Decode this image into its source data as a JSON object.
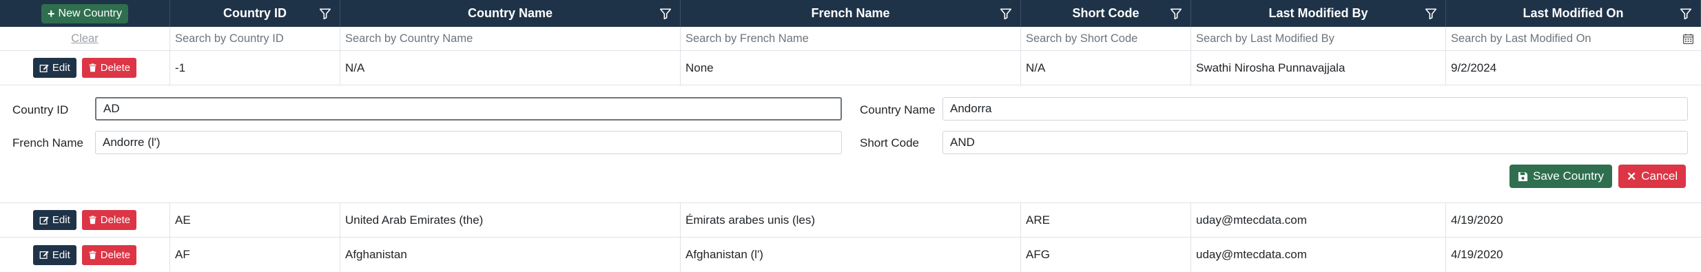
{
  "toolbar": {
    "new_label": "New Country"
  },
  "columns": [
    {
      "label": "Country ID",
      "placeholder": "Search by Country ID"
    },
    {
      "label": "Country Name",
      "placeholder": "Search by Country Name"
    },
    {
      "label": "French Name",
      "placeholder": "Search by French Name"
    },
    {
      "label": "Short Code",
      "placeholder": "Search by Short Code"
    },
    {
      "label": "Last Modified By",
      "placeholder": "Search by Last Modified By"
    },
    {
      "label": "Last Modified On",
      "placeholder": "Search by Last Modified On"
    }
  ],
  "filter": {
    "clear_label": "Clear"
  },
  "row_actions": {
    "edit_label": "Edit",
    "delete_label": "Delete"
  },
  "rows": [
    {
      "id": "-1",
      "name": "N/A",
      "french": "None",
      "code": "N/A",
      "modified_by": "Swathi Nirosha Punnavajjala",
      "modified_on": "9/2/2024"
    },
    {
      "id": "AE",
      "name": "United Arab Emirates (the)",
      "french": "Émirats arabes unis (les)",
      "code": "ARE",
      "modified_by": "uday@mtecdata.com",
      "modified_on": "4/19/2020"
    },
    {
      "id": "AF",
      "name": "Afghanistan",
      "french": "Afghanistan (l')",
      "code": "AFG",
      "modified_by": "uday@mtecdata.com",
      "modified_on": "4/19/2020"
    }
  ],
  "edit_form": {
    "country_id_label": "Country ID",
    "country_id_value": "AD",
    "country_name_label": "Country Name",
    "country_name_value": "Andorra",
    "french_name_label": "French Name",
    "french_name_value": "Andorre (l')",
    "short_code_label": "Short Code",
    "short_code_value": "AND",
    "save_label": "Save Country",
    "cancel_label": "Cancel"
  },
  "colors": {
    "header_bg": "#1f3348",
    "save": "#2f6f4f",
    "danger": "#dc3545"
  }
}
